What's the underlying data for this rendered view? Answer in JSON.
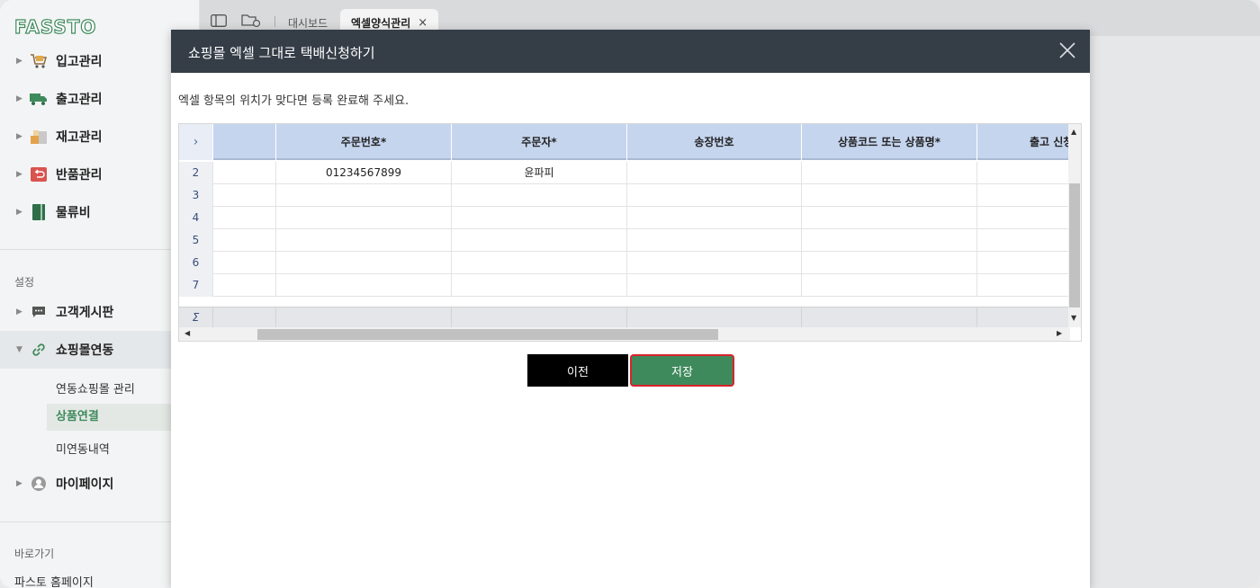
{
  "brand": {
    "logo_text": "FASSTO",
    "accent": "#3f8a5c"
  },
  "sidebar": {
    "items": [
      {
        "label": "입고관리",
        "icon": "cart-icon"
      },
      {
        "label": "출고관리",
        "icon": "truck-icon"
      },
      {
        "label": "재고관리",
        "icon": "boxes-icon"
      },
      {
        "label": "반품관리",
        "icon": "return-icon"
      },
      {
        "label": "물류비",
        "icon": "book-icon"
      }
    ],
    "settings_label": "설정",
    "settings_items": [
      {
        "label": "고객게시판",
        "icon": "chat-icon"
      },
      {
        "label": "쇼핑몰연동",
        "icon": "link-icon"
      }
    ],
    "sub_items": [
      "연동쇼핑몰 관리",
      "상품연결",
      "미연동내역"
    ],
    "mypage_label": "마이페이지",
    "shortcut_label": "바로가기",
    "shortcut_item": "파스토 홈페이지"
  },
  "tabs": {
    "dashboard": "대시보드",
    "active": "엑셀양식관리",
    "close_glyph": "×"
  },
  "modal": {
    "title": "쇼핑몰 엑셀 그대로 택배신청하기",
    "instruction": "엑셀 항목의 위치가 맞다면 등록 완료해 주세요.",
    "columns": [
      "",
      "주문번호*",
      "주문자*",
      "송장번호",
      "상품코드 또는 상품명*",
      "출고 신청"
    ],
    "rows": [
      {
        "index": "2",
        "cells": [
          "",
          "01234567899",
          "윤파피",
          "",
          "",
          ""
        ]
      },
      {
        "index": "3",
        "cells": [
          "",
          "",
          "",
          "",
          "",
          ""
        ]
      },
      {
        "index": "4",
        "cells": [
          "",
          "",
          "",
          "",
          "",
          ""
        ]
      },
      {
        "index": "5",
        "cells": [
          "",
          "",
          "",
          "",
          "",
          ""
        ]
      },
      {
        "index": "6",
        "cells": [
          "",
          "",
          "",
          "",
          "",
          ""
        ]
      },
      {
        "index": "7",
        "cells": [
          "",
          "",
          "",
          "",
          "",
          ""
        ]
      }
    ],
    "sum_symbol": "Σ",
    "expand_glyph": "›",
    "buttons": {
      "prev": "이전",
      "save": "저장"
    }
  }
}
